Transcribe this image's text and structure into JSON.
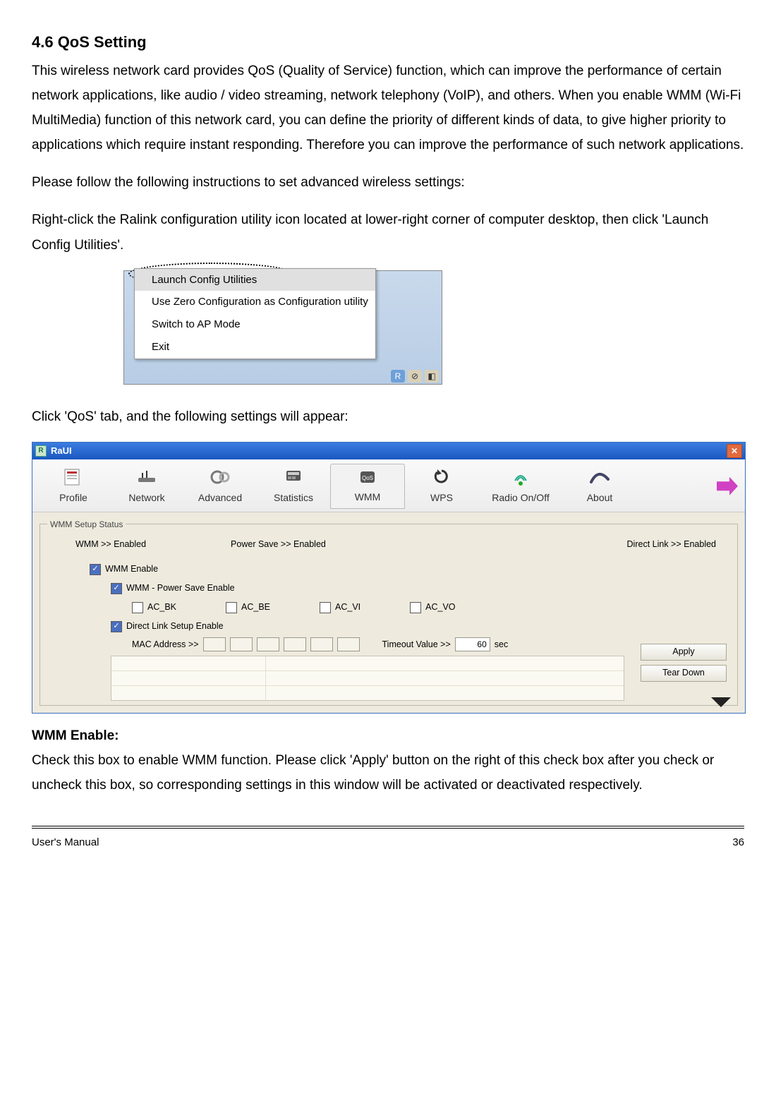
{
  "heading": "4.6 QoS Setting",
  "para1": "This wireless network card provides QoS (Quality of Service) function, which can improve the performance of certain network applications, like audio / video streaming, network telephony (VoIP), and others. When you enable WMM (Wi-Fi MultiMedia) function of this network card, you can define the priority of different kinds of data, to give higher priority to applications which require instant responding. Therefore you can improve the performance of such network applications.",
  "para2": "Please follow the following instructions to set advanced wireless settings:",
  "para3": "Right-click the Ralink configuration utility icon located at lower-right corner of computer desktop, then click 'Launch Config Utilities'.",
  "ctx_menu": {
    "items": [
      "Launch Config Utilities",
      "Use Zero Configuration as Configuration utility",
      "Switch to AP Mode",
      "Exit"
    ]
  },
  "para4": "Click 'QoS' tab, and the following settings will appear:",
  "window": {
    "title": "RaUI",
    "title_icon_text": "R",
    "tabs": [
      "Profile",
      "Network",
      "Advanced",
      "Statistics",
      "WMM",
      "WPS",
      "Radio On/Off",
      "About"
    ],
    "active_tab_index": 4,
    "group_legend": "WMM Setup Status",
    "status": {
      "wmm": "WMM >> Enabled",
      "power": "Power Save >> Enabled",
      "direct": "Direct Link >> Enabled"
    },
    "wmm_enable_label": "WMM Enable",
    "power_save_label": "WMM - Power Save Enable",
    "ac": [
      "AC_BK",
      "AC_BE",
      "AC_VI",
      "AC_VO"
    ],
    "direct_link_label": "Direct Link Setup Enable",
    "mac_label": "MAC Address >>",
    "timeout_label": "Timeout Value >>",
    "timeout_value": "60",
    "timeout_unit": "sec",
    "apply_btn": "Apply",
    "teardown_btn": "Tear Down"
  },
  "wmm_heading": "WMM Enable:",
  "wmm_para": "Check this box to enable WMM function. Please click 'Apply' button on the right of this check box after you check or uncheck this box, so corresponding settings in this window will be activated or deactivated respectively.",
  "footer_left": "User's Manual",
  "footer_right": "36"
}
